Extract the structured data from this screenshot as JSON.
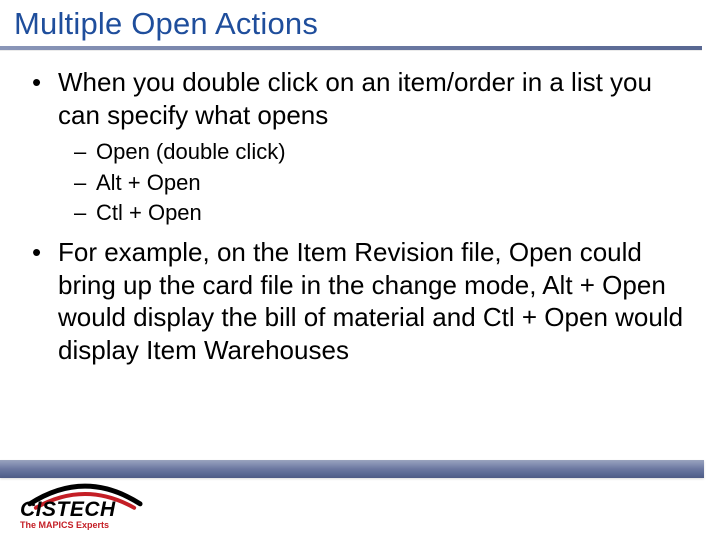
{
  "title": "Multiple Open Actions",
  "bullets": {
    "b1": "When you double click on an item/order in a list you can specify what opens",
    "sub": {
      "s1": "Open (double click)",
      "s2": "Alt + Open",
      "s3": "Ctl + Open"
    },
    "b2": "For example, on the Item Revision file, Open could bring up the card file in the change mode, Alt + Open would display the bill of material and Ctl + Open would display Item Warehouses"
  },
  "logo": {
    "name": "CISTECH",
    "tagline": "The MAPICS Experts"
  }
}
